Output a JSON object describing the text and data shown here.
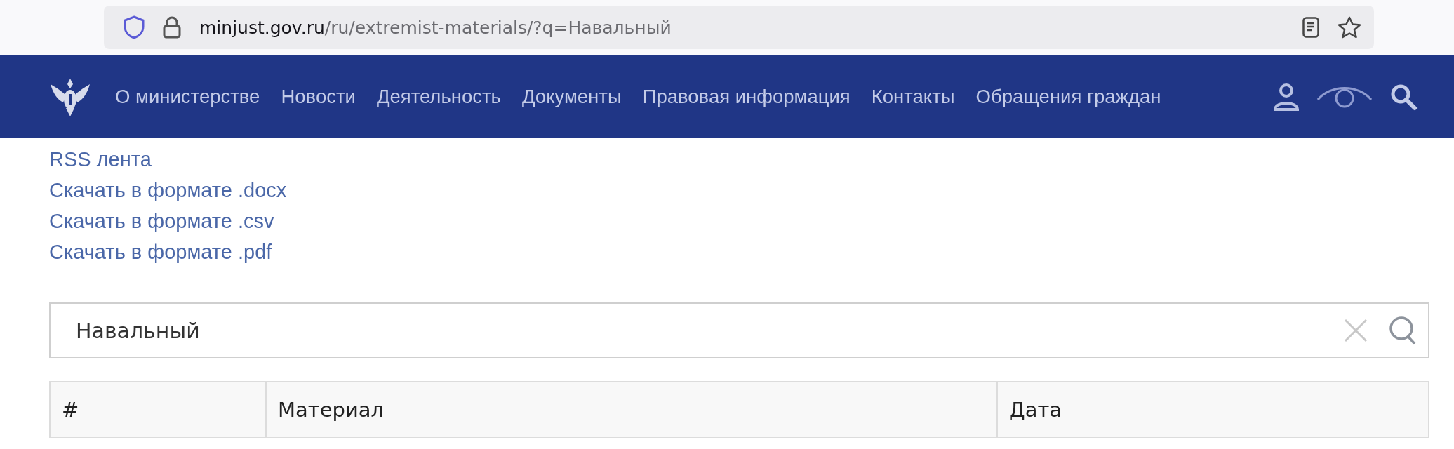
{
  "browser": {
    "url_host": "minjust.gov.ru",
    "url_path": "/ru/extremist-materials/?q=Навальный"
  },
  "nav": {
    "items": [
      "О министерстве",
      "Новости",
      "Деятельность",
      "Документы",
      "Правовая информация",
      "Контакты",
      "Обращения граждан"
    ]
  },
  "links": [
    "RSS лента",
    "Скачать в формате .docx",
    "Скачать в формате .csv",
    "Скачать в формате .pdf"
  ],
  "search": {
    "value": "Навальный"
  },
  "table": {
    "columns": [
      "#",
      "Материал",
      "Дата"
    ]
  }
}
